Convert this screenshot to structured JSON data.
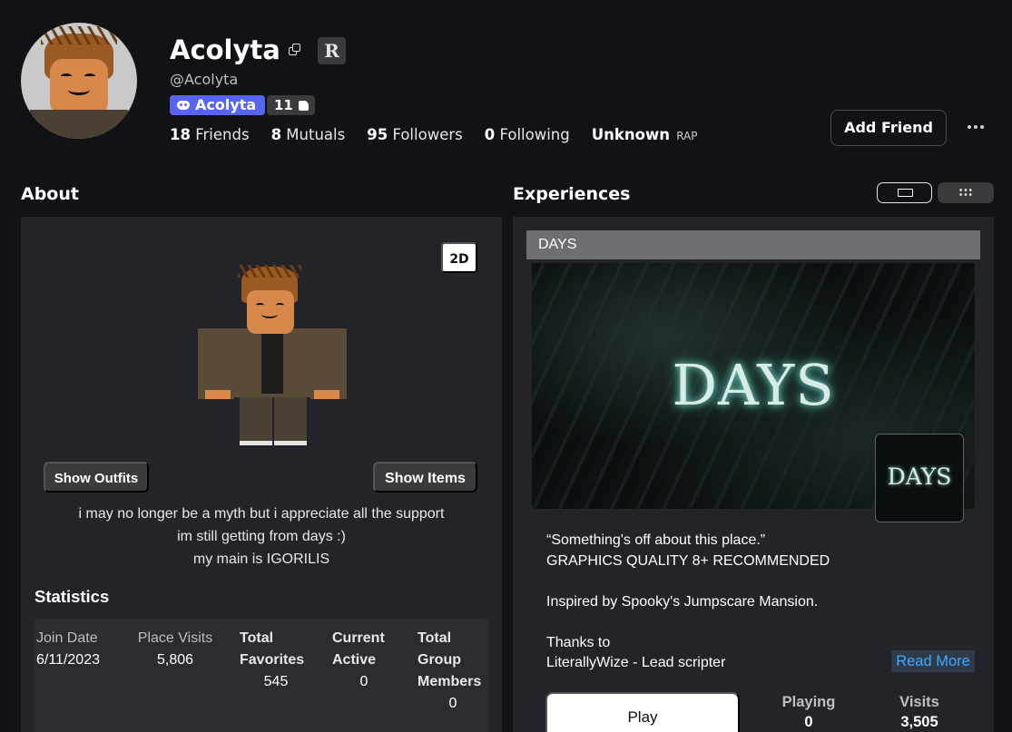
{
  "profile": {
    "display_name": "Acolyta",
    "username": "@Acolyta",
    "badge_letter": "R",
    "discord_tag": "Acolyta",
    "likes_count": "11",
    "stats": [
      {
        "value": "18",
        "label": "Friends"
      },
      {
        "value": "8",
        "label": "Mutuals"
      },
      {
        "value": "95",
        "label": "Followers"
      },
      {
        "value": "0",
        "label": "Following"
      },
      {
        "value": "Unknown",
        "label": "RAP"
      }
    ],
    "add_friend_label": "Add Friend"
  },
  "about": {
    "heading": "About",
    "view_mode_label": "2D",
    "show_outfits_label": "Show Outfits",
    "show_items_label": "Show Items",
    "description_lines": [
      "i may no longer be a myth but i appreciate all the support",
      "im still getting from days :)",
      "my main is IGORILIS"
    ],
    "statistics_heading": "Statistics",
    "statistics": [
      {
        "label_lines": [
          "Join Date"
        ],
        "value": "6/11/2023"
      },
      {
        "label_lines": [
          "Place Visits"
        ],
        "value": "5,806"
      },
      {
        "label_lines": [
          "Total",
          "Favorites"
        ],
        "value": "545"
      },
      {
        "label_lines": [
          "Current",
          "Active"
        ],
        "value": "0"
      },
      {
        "label_lines": [
          "Total",
          "Group",
          "Members"
        ],
        "value": "0"
      }
    ]
  },
  "experiences": {
    "heading": "Experiences",
    "game": {
      "title": "DAYS",
      "thumbnail_text": "DAYS",
      "icon_text": "DAYS",
      "description_lines": [
        "“Something's off about this place.”",
        "GRAPHICS QUALITY 8+ RECOMMENDED",
        "",
        "Inspired by Spooky's Jumpscare Mansion.",
        "",
        "Thanks to",
        "LiterallyWize - Lead scripter"
      ],
      "read_more_label": "Read More",
      "play_label": "Play",
      "playing_label": "Playing",
      "playing_value": "0",
      "visits_label": "Visits",
      "visits_value": "3,505"
    }
  },
  "icons": {
    "copy": "copy-icon",
    "discord": "discord-icon",
    "like": "thumbs-up-icon",
    "more": "more-options-icon",
    "single_view": "single-view-icon",
    "grid_view": "grid-view-icon"
  },
  "colors": {
    "background": "#111216",
    "panel": "#232429",
    "discord": "#5865f2",
    "link": "#3fa9ff"
  }
}
